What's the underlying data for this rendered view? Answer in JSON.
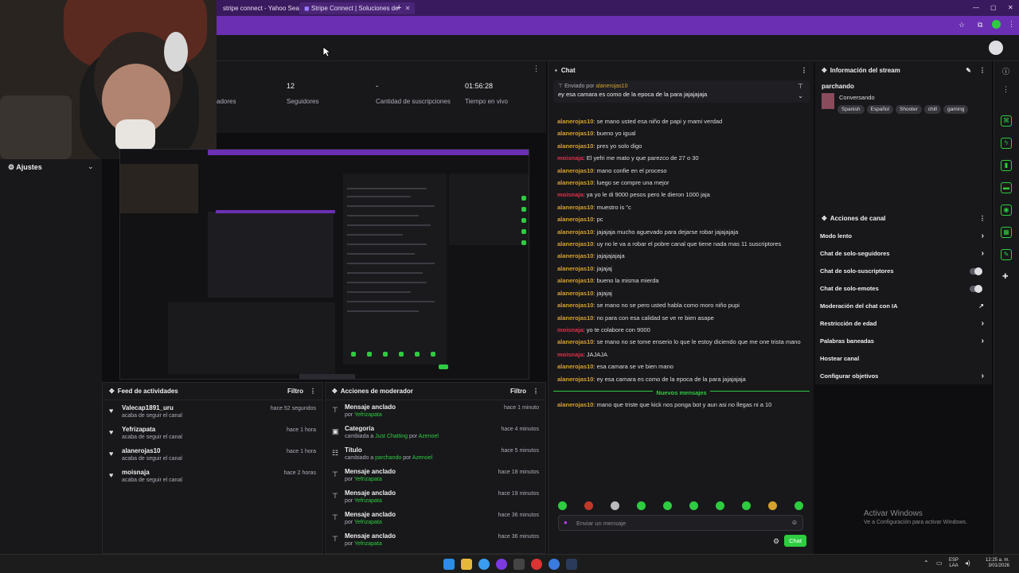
{
  "browser": {
    "tabs": [
      {
        "label": "stripe connect - Yahoo Search"
      },
      {
        "label": "Stripe Connect | Soluciones de"
      }
    ],
    "new_tab": "+"
  },
  "sidebar": {
    "settings_label": "Ajustes"
  },
  "stats": [
    {
      "value": "",
      "label": "adores"
    },
    {
      "value": "12",
      "label": "Seguidores"
    },
    {
      "value": "-",
      "label": "Cantidad de suscripciones"
    },
    {
      "value": "01:56:28",
      "label": "Tiempo en vivo"
    }
  ],
  "activity": {
    "title": "Feed de actividades",
    "filter": "Filtro",
    "items": [
      {
        "name": "Valecap1891_uru",
        "sub": "acaba de seguir el canal",
        "time": "hace 52 segundos"
      },
      {
        "name": "Yefrizapata",
        "sub": "acaba de seguir el canal",
        "time": "hace 1 hora"
      },
      {
        "name": "alanerojas10",
        "sub": "acaba de seguir el canal",
        "time": "hace 1 hora"
      },
      {
        "name": "moisnaja",
        "sub": "acaba de seguir el canal",
        "time": "hace 2 horas"
      }
    ]
  },
  "modactions": {
    "title": "Acciones de moderador",
    "filter": "Filtro",
    "items": [
      {
        "name": "Mensaje anclado",
        "sub_prefix": "por",
        "sub_user": "Yefrizapata",
        "time": "hace 1 minuto"
      },
      {
        "name": "Categoría",
        "sub_prefix": "cambiada a",
        "sub_user": "Just Chatting",
        "by": "Azenoel",
        "time": "hace 4 minutos"
      },
      {
        "name": "Título",
        "sub_prefix": "cambiado a",
        "sub_user": "parchando",
        "by": "Azenoel",
        "time": "hace 5 minutos"
      },
      {
        "name": "Mensaje anclado",
        "sub_prefix": "por",
        "sub_user": "Yefrizapata",
        "time": "hace 18 minutos"
      },
      {
        "name": "Mensaje anclado",
        "sub_prefix": "por",
        "sub_user": "Yefrizapata",
        "time": "hace 19 minutos"
      },
      {
        "name": "Mensaje anclado",
        "sub_prefix": "por",
        "sub_user": "Yefrizapata",
        "time": "hace 36 minutos"
      },
      {
        "name": "Mensaje anclado",
        "sub_prefix": "por",
        "sub_user": "Yefrizapata",
        "time": "hace 36 minutos"
      }
    ]
  },
  "chat": {
    "title": "Chat",
    "pinned_by_prefix": "Enviado por",
    "pinned_by_user": "alanerojas10",
    "pinned_text": "ey esa camara es como de la epoca de la para jajajajaja",
    "messages": [
      {
        "user": "alanerojas10",
        "text": "se mano usted esa niño de papi y mami verdad",
        "red": false
      },
      {
        "user": "alanerojas10",
        "text": "bueno yo igual",
        "red": false
      },
      {
        "user": "alanerojas10",
        "text": "pres yo solo digo",
        "red": false
      },
      {
        "user": "moisnaja",
        "text": "El yefri me mato y que parezco de 27 o 30",
        "red": true
      },
      {
        "user": "alanerojas10",
        "text": "mano confie en el proceso",
        "red": false
      },
      {
        "user": "alanerojas10",
        "text": "luego se compre una mejor",
        "red": false
      },
      {
        "user": "moisnaja",
        "text": "ya yo le di 9000 pesos pero le dieron 1000 jaja",
        "red": true
      },
      {
        "user": "alanerojas10",
        "text": "muestro is \"c",
        "red": false
      },
      {
        "user": "alanerojas10",
        "text": "pc",
        "red": false
      },
      {
        "user": "alanerojas10",
        "text": "jajajaja mucho aguevado para dejarse robar jajajajaja",
        "red": false
      },
      {
        "user": "alanerojas10",
        "text": "uy no le va a robar el pobre canal que tiene nada mas 11 suscriptores",
        "red": false
      },
      {
        "user": "alanerojas10",
        "text": "jajajajajaja",
        "red": false
      },
      {
        "user": "alanerojas10",
        "text": "jajajaj",
        "red": false
      },
      {
        "user": "alanerojas10",
        "text": "bueno la misma mierda",
        "red": false
      },
      {
        "user": "alanerojas10",
        "text": "jajajaj",
        "red": false
      },
      {
        "user": "alanerojas10",
        "text": "se mano no se pero usted habla como moro niño pupi",
        "red": false
      },
      {
        "user": "alanerojas10",
        "text": "no para con esa calidad se ve re bien asape",
        "red": false
      },
      {
        "user": "moisnaja",
        "text": "yo te colabore con 9000",
        "red": true
      },
      {
        "user": "alanerojas10",
        "text": "se mano no se tome enserio lo que le estoy diciendo que me one trista mano",
        "red": false
      },
      {
        "user": "moisnaja",
        "text": "JAJAJA",
        "red": true
      },
      {
        "user": "alanerojas10",
        "text": "esa camara se ve bien mano",
        "red": false
      },
      {
        "user": "alanerojas10",
        "text": "ey esa camara es como de la epoca de la para jajajajaja",
        "red": false
      }
    ],
    "new_messages": "Nuevos mensajes",
    "last_message": {
      "user": "alanerojas10",
      "text": "mano que triste que kick nos ponga bot y aun asi no llegas ni a 10"
    },
    "placeholder": "Enviar un mensaje",
    "send_label": "Chat"
  },
  "stream_info": {
    "title": "Información del stream",
    "stream_title": "parchando",
    "category": "Conversando",
    "tags": [
      "Spanish",
      "Español",
      "Shooter",
      "chill",
      "gaming"
    ]
  },
  "channel_actions": {
    "title": "Acciones de canal",
    "items": [
      {
        "label": "Modo lento",
        "control": "chevron"
      },
      {
        "label": "Chat de solo-seguidores",
        "control": "chevron"
      },
      {
        "label": "Chat de solo-suscriptores",
        "control": "toggle"
      },
      {
        "label": "Chat de solo-emotes",
        "control": "toggle"
      },
      {
        "label": "Moderación del chat con IA",
        "control": "ext"
      },
      {
        "label": "Restricción de edad",
        "control": "chevron"
      },
      {
        "label": "Palabras baneadas",
        "control": "chevron"
      },
      {
        "label": "Hostear canal",
        "control": "none"
      },
      {
        "label": "Configurar objetivos",
        "control": "chevron"
      }
    ]
  },
  "windows": {
    "activate_title": "Activar Windows",
    "activate_sub": "Ve a Configuración para activar Windows."
  },
  "taskbar": {
    "lang": "ESP",
    "lang_sub": "LAA",
    "time": "12:25 a. m.",
    "date": "3/01/2026"
  },
  "colors": {
    "accent": "#2ecc40",
    "browser": "#6b2fb3",
    "username": "#d6a12e"
  }
}
